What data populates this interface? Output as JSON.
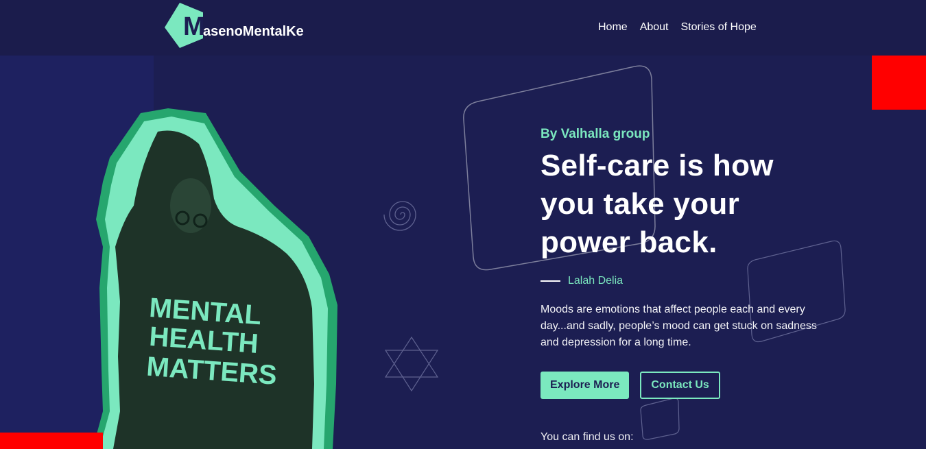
{
  "brand": {
    "logo_initial": "M",
    "logo_text": "asenoMentalKe"
  },
  "nav": {
    "items": [
      "Home",
      "About",
      "Stories of Hope"
    ]
  },
  "hero": {
    "author_line": "By Valhalla group",
    "title": "Self-care is how you take your power back.",
    "quote_author": "Lalah Delia",
    "description": "Moods are emotions that affect people each and every day...and sadly, people’s mood can get stuck on sadness and depression for a long time.",
    "primary_button": "Explore More",
    "secondary_button": "Contact Us",
    "find_us": "You can find us on:",
    "shirt_text": [
      "MENTAL",
      "HEALTH",
      "MATTERS"
    ]
  },
  "colors": {
    "background": "#1c1e52",
    "accent": "#7be8bf",
    "red": "#ff0000",
    "photo_green": "#1e3328"
  },
  "icons": [
    "hexagon-logo-icon",
    "spiral-icon",
    "star-of-david-icon"
  ]
}
